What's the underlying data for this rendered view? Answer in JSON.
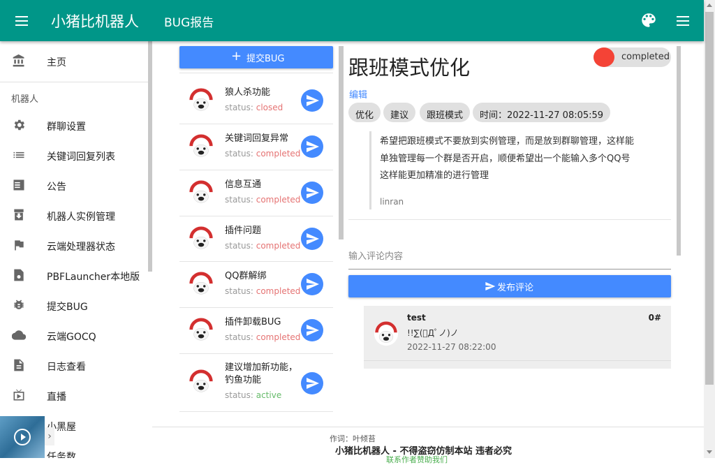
{
  "appbar": {
    "brand": "小猪比机器人",
    "subtitle": "BUG报告",
    "icons": [
      "menu-icon",
      "palette-icon",
      "more-menu-icon"
    ]
  },
  "sidebar": {
    "home": "主页",
    "section": "机器人",
    "items": [
      {
        "label": "群聊设置",
        "icon": "gear-icon"
      },
      {
        "label": "关键词回复列表",
        "icon": "list-icon"
      },
      {
        "label": "公告",
        "icon": "announcement-icon"
      },
      {
        "label": "机器人实例管理",
        "icon": "archive-icon"
      },
      {
        "label": "云端处理器状态",
        "icon": "flag-icon"
      },
      {
        "label": "PBFLauncher本地版",
        "icon": "file-icon"
      },
      {
        "label": "提交BUG",
        "icon": "bug-icon"
      },
      {
        "label": "云端GOCQ",
        "icon": "cloud-icon"
      },
      {
        "label": "日志查看",
        "icon": "document-icon"
      },
      {
        "label": "直播",
        "icon": "live-tv-icon"
      },
      {
        "label": "小黑屋",
        "icon": "blocked-room-icon"
      },
      {
        "label": "任务数",
        "icon": "task-icon"
      }
    ]
  },
  "bug_list": {
    "submit_label": "提交BUG",
    "items": [
      {
        "title": "狼人杀功能",
        "status_prefix": "status: ",
        "status": "closed"
      },
      {
        "title": "关键词回复异常",
        "status_prefix": "status: ",
        "status": "completed"
      },
      {
        "title": "信息互通",
        "status_prefix": "status: ",
        "status": "completed"
      },
      {
        "title": "插件问题",
        "status_prefix": "status: ",
        "status": "completed"
      },
      {
        "title": "QQ群解绑",
        "status_prefix": "status: ",
        "status": "completed"
      },
      {
        "title": "插件卸载BUG",
        "status_prefix": "status: ",
        "status": "completed"
      },
      {
        "title": "建议增加新功能，钓鱼功能",
        "status_prefix": "status: ",
        "status": "active"
      }
    ]
  },
  "detail": {
    "title": "跟班模式优化",
    "status": "completed",
    "edit_label": "编辑",
    "tags": [
      "优化",
      "建议",
      "跟班模式",
      "时间：2022-11-27 08:05:59"
    ],
    "body": "希望把跟班模式不要放到实例管理，而是放到群聊管理，这样能单独管理每一个群是否开启，顺便希望出一个能输入多个QQ号这样能更加精准的进行管理",
    "author": "linran",
    "comment_placeholder": "输入评论内容",
    "publish_label": "发布评论",
    "status_color": "#f44336"
  },
  "comments": [
    {
      "user": "test",
      "floor": "0#",
      "text": "!!∑(ﾟДﾟノ)ノ",
      "time": "2022-11-27 08:22:00"
    }
  ],
  "footer": {
    "credit": "作词：叶倾苔",
    "slogan": "小猪比机器人 - 不得盗窃仿制本站 违者必究",
    "contact": "联系作者赞助我们"
  },
  "colors": {
    "primary": "#009688",
    "accent": "#448aff",
    "completed": "#e57373",
    "active": "#66bb6a"
  }
}
